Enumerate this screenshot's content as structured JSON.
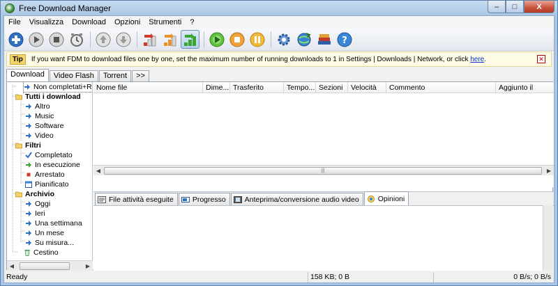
{
  "window": {
    "title": "Free Download Manager",
    "min": "–",
    "max": "□",
    "close": "X"
  },
  "menu": [
    "File",
    "Visualizza",
    "Download",
    "Opzioni",
    "Strumenti",
    "?"
  ],
  "toolbar": {
    "icons": [
      "add-download-icon",
      "start-icon",
      "stop-icon",
      "scheduler-icon",
      "move-up-icon",
      "move-down-icon",
      "download-speed-low-icon",
      "download-speed-medium-icon",
      "download-speed-high-icon",
      "start-all-icon",
      "stop-all-icon",
      "pause-all-icon",
      "settings-gear-icon",
      "site-explorer-icon",
      "books-icon",
      "help-icon"
    ]
  },
  "tip": {
    "badge": "Tip",
    "text": "If you want FDM to download files one by one, set the maximum number of running downloads to 1 in Settings | Downloads | Network, or click ",
    "link": "here",
    "end": "."
  },
  "tabs": [
    "Download",
    "Video Flash",
    "Torrent",
    ">>"
  ],
  "tree": [
    {
      "label": "Non completati+Recenti",
      "bold": false,
      "icon": "blue-arrow"
    },
    {
      "label": "Tutti i download",
      "bold": true,
      "icon": "folder"
    },
    {
      "label": "Altro",
      "bold": false,
      "icon": "blue-arrow"
    },
    {
      "label": "Music",
      "bold": false,
      "icon": "blue-arrow"
    },
    {
      "label": "Software",
      "bold": false,
      "icon": "blue-arrow"
    },
    {
      "label": "Video",
      "bold": false,
      "icon": "blue-arrow"
    },
    {
      "label": "Filtri",
      "bold": true,
      "icon": "folder"
    },
    {
      "label": "Completato",
      "bold": false,
      "icon": "check"
    },
    {
      "label": "In esecuzione",
      "bold": false,
      "icon": "green-arrow"
    },
    {
      "label": "Arrestato",
      "bold": false,
      "icon": "red-square"
    },
    {
      "label": "Pianificato",
      "bold": false,
      "icon": "calendar"
    },
    {
      "label": "Archivio",
      "bold": true,
      "icon": "folder"
    },
    {
      "label": "Oggi",
      "bold": false,
      "icon": "blue-arrow"
    },
    {
      "label": "Ieri",
      "bold": false,
      "icon": "blue-arrow"
    },
    {
      "label": "Una settimana",
      "bold": false,
      "icon": "blue-arrow"
    },
    {
      "label": "Un mese",
      "bold": false,
      "icon": "blue-arrow"
    },
    {
      "label": "Su misura...",
      "bold": false,
      "icon": "blue-arrow"
    },
    {
      "label": "Cestino",
      "bold": false,
      "icon": "recycle-bin"
    }
  ],
  "columns": [
    "Nome file",
    "Dime...",
    "Trasferito",
    "Tempo...",
    "Sezioni",
    "Velocità",
    "Commento",
    "Aggiunto il"
  ],
  "bottom_tabs": [
    "File attività eseguite",
    "Progresso",
    "Anteprima/conversione audio video",
    "Opinioni"
  ],
  "status": {
    "left": "Ready",
    "mid": "158 KB; 0 B",
    "right": "0 B/s; 0 B/s"
  },
  "scroll": {
    "grip": "|||",
    "left": "◀",
    "right": "▶"
  },
  "colors": {
    "accent": "#2f6fc4",
    "title_bg": "#a9c6e6"
  }
}
